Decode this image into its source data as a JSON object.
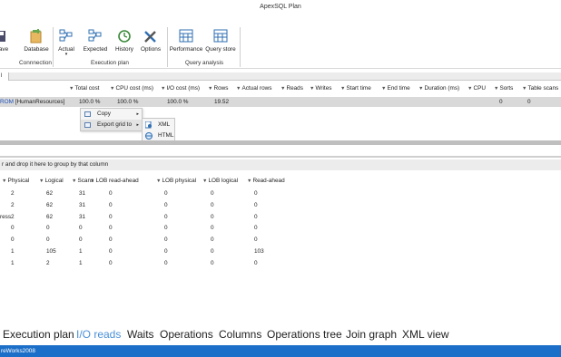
{
  "window": {
    "title": "ApexSQL Plan"
  },
  "ribbon": {
    "save_label": "ave",
    "database_label": "Database",
    "actual_label": "Actual",
    "expected_label": "Expected",
    "history_label": "History",
    "options_label": "Options",
    "performance_label": "Performance",
    "query_store_label": "Query store",
    "group_connection": "Connnection",
    "group_execution_plan": "Execution plan",
    "group_query_analysis": "Query analysis"
  },
  "tabstrip": {
    "tab_label": "l"
  },
  "grid_top": {
    "headers": [
      "Total cost",
      "CPU cost (ms)",
      "I/O cost (ms)",
      "Rows",
      "Actual rows",
      "Reads",
      "Writes",
      "Start time",
      "End time",
      "Duration (ms)",
      "CPU",
      "Sorts",
      "Table scans"
    ],
    "row": {
      "statement_keyword": "ROM",
      "statement_rest": " [HumanResources]",
      "total_cost": "100.0 %",
      "cpu_cost": "100.0 %",
      "io_cost": "100.0 %",
      "rows": "19.52",
      "sorts": "0",
      "table_scans": "0"
    }
  },
  "context_menu": {
    "copy_label": "Copy",
    "export_label": "Export grid to",
    "submenu": {
      "xml_label": "XML",
      "html_label": "HTML"
    }
  },
  "group_hint": "r and drop it here to group by that column",
  "grid_bottom": {
    "headers": [
      "Physical",
      "Logical",
      "Scans",
      "LOB read-ahead",
      "LOB physical",
      "LOB logical",
      "Read-ahead"
    ],
    "rows": [
      {
        "c0": "",
        "physical": "2",
        "logical": "62",
        "scans": "31",
        "lob_ra": "0",
        "lob_phys": "0",
        "lob_log": "0",
        "ra": "0"
      },
      {
        "c0": "",
        "physical": "2",
        "logical": "62",
        "scans": "31",
        "lob_ra": "0",
        "lob_phys": "0",
        "lob_log": "0",
        "ra": "0"
      },
      {
        "c0": "ress",
        "physical": "2",
        "logical": "62",
        "scans": "31",
        "lob_ra": "0",
        "lob_phys": "0",
        "lob_log": "0",
        "ra": "0"
      },
      {
        "c0": "",
        "physical": "0",
        "logical": "0",
        "scans": "0",
        "lob_ra": "0",
        "lob_phys": "0",
        "lob_log": "0",
        "ra": "0"
      },
      {
        "c0": "",
        "physical": "0",
        "logical": "0",
        "scans": "0",
        "lob_ra": "0",
        "lob_phys": "0",
        "lob_log": "0",
        "ra": "0"
      },
      {
        "c0": "",
        "physical": "1",
        "logical": "105",
        "scans": "1",
        "lob_ra": "0",
        "lob_phys": "0",
        "lob_log": "0",
        "ra": "103"
      },
      {
        "c0": "",
        "physical": "1",
        "logical": "2",
        "scans": "1",
        "lob_ra": "0",
        "lob_phys": "0",
        "lob_log": "0",
        "ra": "0"
      }
    ]
  },
  "bottom_tabs": [
    {
      "label": "Execution plan"
    },
    {
      "label": "I/O reads"
    },
    {
      "label": "Waits"
    },
    {
      "label": "Operations"
    },
    {
      "label": "Columns"
    },
    {
      "label": "Operations tree"
    },
    {
      "label": "Join graph"
    },
    {
      "label": "XML view"
    }
  ],
  "status": {
    "text": "reWorks2008"
  },
  "colors": {
    "status_bar": "#1c6fc8",
    "active_tab": "#4a90d9",
    "selected_row": "#d9d9d9"
  }
}
